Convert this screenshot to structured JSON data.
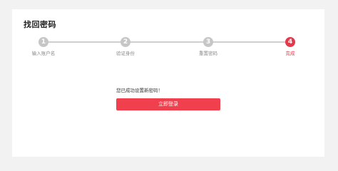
{
  "page": {
    "title": "找回密码"
  },
  "steps": [
    {
      "number": "1",
      "label": "输入账户名",
      "active": false
    },
    {
      "number": "2",
      "label": "验证身份",
      "active": false
    },
    {
      "number": "3",
      "label": "重置密码",
      "active": false
    },
    {
      "number": "4",
      "label": "完成",
      "active": true
    }
  ],
  "result": {
    "message": "您已成功设置新密码！",
    "login_button_label": "立即登录"
  },
  "colors": {
    "accent": "#e33a4c",
    "inactive_step": "#c6c6c6",
    "background": "#f2f2f2"
  }
}
